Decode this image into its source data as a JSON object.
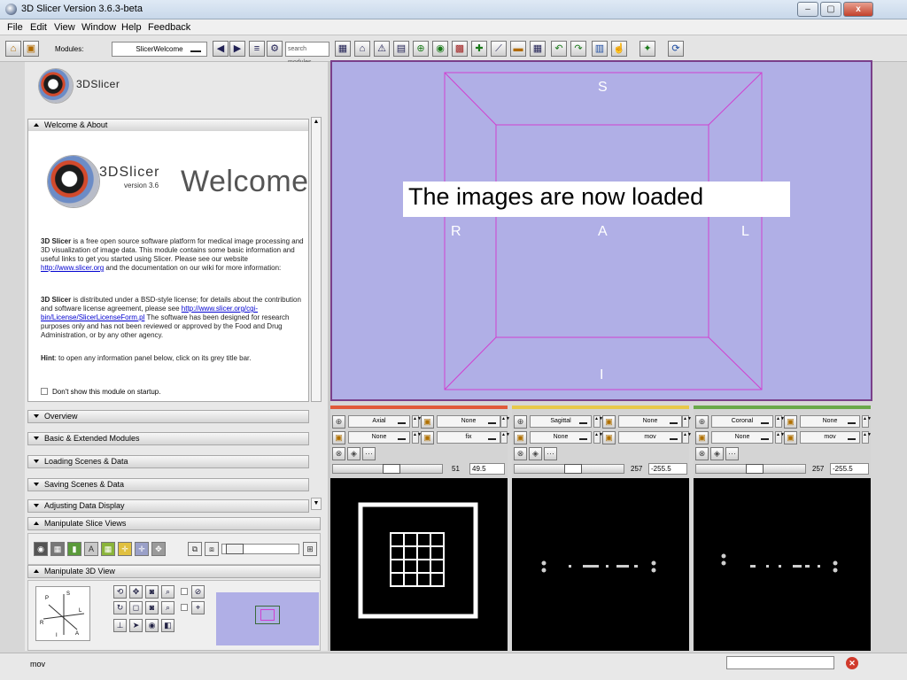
{
  "window": {
    "title": "3D Slicer Version 3.6.3-beta",
    "controls": [
      "–",
      "▢",
      "x"
    ]
  },
  "menu": [
    "File",
    "Edit",
    "View",
    "Window",
    "Help",
    "Feedback"
  ],
  "toolbar": {
    "modules_label": "Modules:",
    "modules_value": "SlicerWelcome",
    "search_placeholder": "search modules"
  },
  "logo": {
    "text": "3DSlicer"
  },
  "welcome": {
    "section": "Welcome & About",
    "logo_text": "3DSlicer",
    "version": "version 3.6",
    "title": "Welcome",
    "p1_bold": "3D Slicer",
    "p1": " is a free open source software platform for medical image processing and 3D visualization of image data. This module contains some basic information and useful links to get you started using Slicer. Please see our website ",
    "p1_link": "http://www.slicer.org",
    "p1_tail": " and the documentation on our wiki for more information:",
    "p2_bold": "3D Slicer",
    "p2": " is distributed under a BSD-style license; for details about the contribution and software license agreement, please see ",
    "p2_link": "http://www.slicer.org/cgi-bin/License/SlicerLicenseForm.pl",
    "p2_tail": " The software has been designed for research purposes only and has not been reviewed or approved by the Food and Drug Administration, or by any other agency.",
    "hint_bold": "Hint",
    "hint": ": to open any information panel below, click on its grey title bar.",
    "dont_show": "Don't show this module on startup."
  },
  "sections": [
    "Overview",
    "Basic & Extended Modules",
    "Loading Scenes & Data",
    "Saving Scenes & Data",
    "Adjusting Data Display"
  ],
  "manipulate_slice": "Manipulate Slice Views",
  "manipulate_3d": "Manipulate 3D View",
  "axes": {
    "p": "P",
    "s": "S",
    "l": "L",
    "r": "R",
    "i": "I",
    "a": "A"
  },
  "view3d": {
    "labels": {
      "top": "S",
      "left": "R",
      "center": "A",
      "right": "L",
      "bottom": "I"
    },
    "overlay": "The images are now loaded"
  },
  "slices": [
    {
      "orientation": "Axial",
      "fg": "None",
      "bg": "fix",
      "label": "None",
      "layer": "None",
      "offset": "51",
      "entry": "49.5",
      "color": "#e05a3a"
    },
    {
      "orientation": "Sagittal",
      "fg": "None",
      "bg": "mov",
      "label": "None",
      "layer": "None",
      "offset": "257",
      "entry": "-255.5",
      "color": "#e8c84a"
    },
    {
      "orientation": "Coronal",
      "fg": "None",
      "bg": "mov",
      "label": "None",
      "layer": "None",
      "offset": "257",
      "entry": "-255.5",
      "color": "#6aa84a"
    }
  ],
  "status": {
    "text": "mov"
  },
  "colors": {
    "view_bg": "#b0afe6",
    "frame": "#d040d0"
  }
}
